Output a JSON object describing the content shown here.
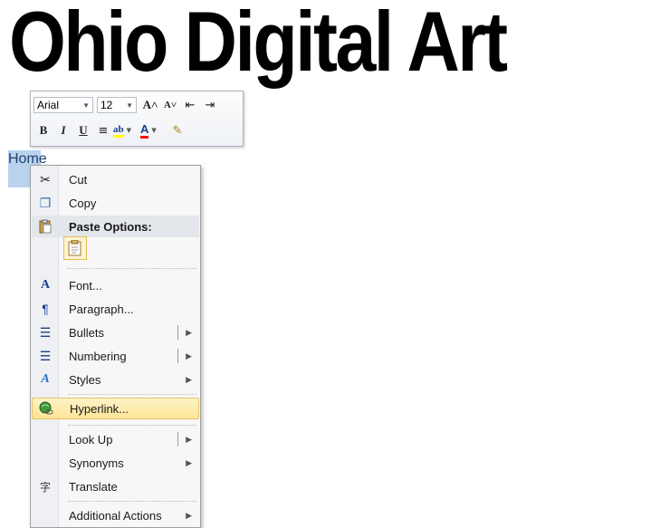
{
  "document": {
    "headline": "Ohio Digital Art",
    "selected_word": "Home"
  },
  "mini_toolbar": {
    "font_name": "Arial",
    "font_size": "12",
    "row1_buttons": [
      {
        "name": "grow-font-icon",
        "glyph": "A˄"
      },
      {
        "name": "shrink-font-icon",
        "glyph": "A˅"
      },
      {
        "name": "decrease-indent-icon",
        "glyph": "⇤"
      },
      {
        "name": "increase-indent-icon",
        "glyph": "⇥"
      }
    ],
    "row2_buttons": [
      {
        "name": "bold-icon",
        "glyph": "B"
      },
      {
        "name": "italic-icon",
        "glyph": "I"
      },
      {
        "name": "underline-icon",
        "glyph": "U"
      },
      {
        "name": "center-align-icon",
        "glyph": "≡"
      },
      {
        "name": "highlight-color-icon",
        "glyph": "ab"
      },
      {
        "name": "font-color-icon",
        "glyph": "A"
      },
      {
        "name": "format-painter-icon",
        "glyph": "✎"
      }
    ],
    "colors": {
      "highlight": "#ffff00",
      "font_color": "#ff0000"
    }
  },
  "context_menu": {
    "items": [
      {
        "label": "Cut",
        "icon": "scissors-icon",
        "glyph": "✂"
      },
      {
        "label": "Copy",
        "icon": "copy-icon",
        "glyph": "❐"
      },
      {
        "label": "Paste Options:",
        "icon": "paste-icon",
        "glyph": "📋",
        "header": true
      },
      {
        "label": "Font...",
        "icon": "font-icon",
        "glyph": "A"
      },
      {
        "label": "Paragraph...",
        "icon": "paragraph-icon",
        "glyph": "¶"
      },
      {
        "label": "Bullets",
        "icon": "bullets-icon",
        "glyph": "☰"
      },
      {
        "label": "Numbering",
        "icon": "numbering-icon",
        "glyph": "☰"
      },
      {
        "label": "Styles",
        "icon": "styles-icon",
        "glyph": "A"
      },
      {
        "label": "Hyperlink...",
        "icon": "hyperlink-icon",
        "glyph": "●"
      },
      {
        "label": "Look Up",
        "icon": "",
        "glyph": ""
      },
      {
        "label": "Synonyms",
        "icon": "",
        "glyph": ""
      },
      {
        "label": "Translate",
        "icon": "translate-icon",
        "glyph": "字"
      },
      {
        "label": "Additional Actions",
        "icon": "",
        "glyph": ""
      }
    ],
    "highlight_color": "#fde496",
    "submenu_arrow": "▶"
  }
}
